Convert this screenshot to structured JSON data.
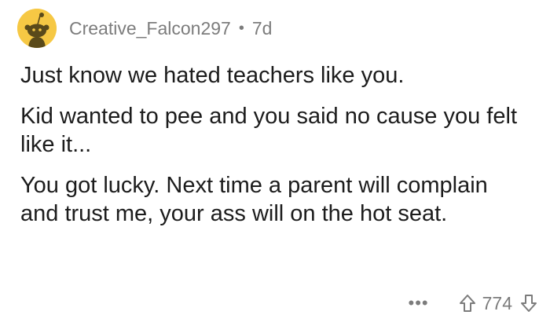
{
  "comment": {
    "username": "Creative_Falcon297",
    "separator": "•",
    "age": "7d",
    "avatar_icon": "reddit-snoo-icon",
    "avatar_color": "#f6c844",
    "paragraphs": [
      "Just know we hated teachers like you.",
      "Kid wanted to pee and you said no cause you felt like it...",
      "You got lucky. Next time a parent will complain and trust me, your ass will on the hot seat."
    ],
    "more_label": "•••",
    "score": "774",
    "upvote_icon": "upvote-arrow-icon",
    "downvote_icon": "downvote-arrow-icon"
  }
}
